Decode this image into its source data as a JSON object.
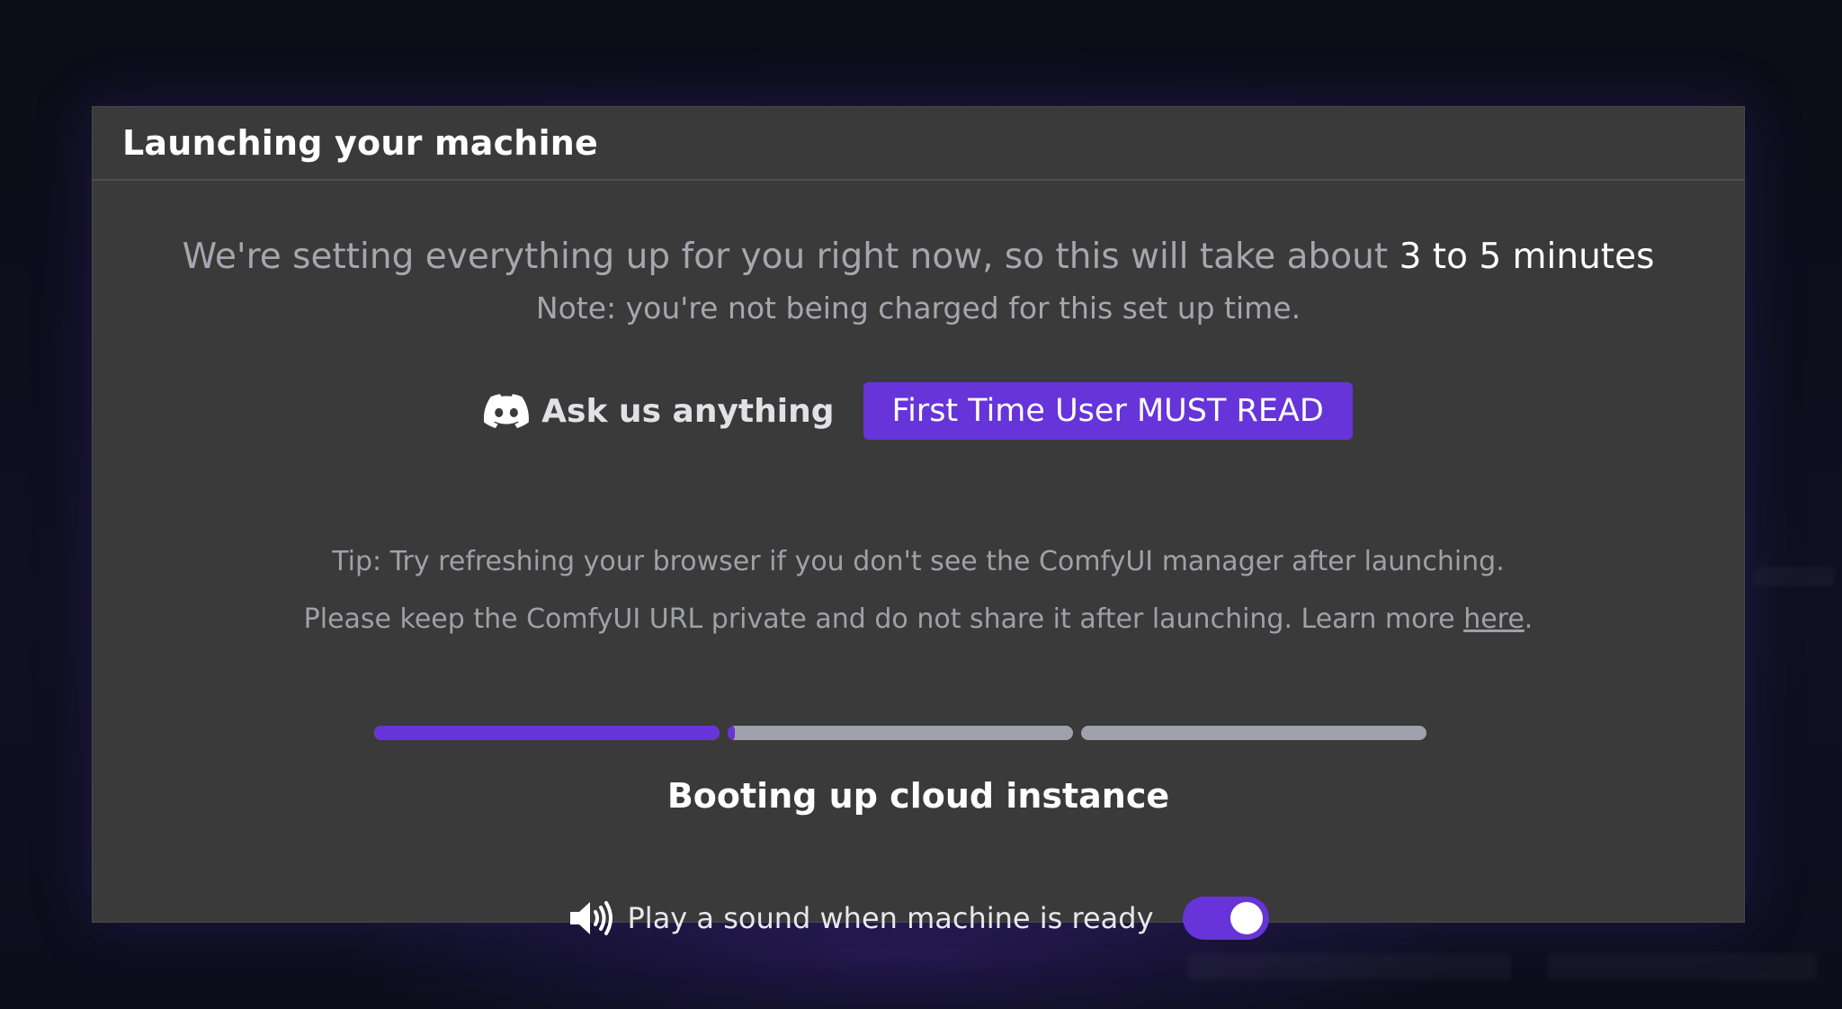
{
  "modal": {
    "title": "Launching your machine",
    "intro_text": "We're setting everything up for you right now, so this will take about",
    "intro_highlight": "3 to 5 minutes",
    "note": "Note: you're not being charged for this set up time.",
    "discord_label": "Ask us anything",
    "must_read_label": "First Time User MUST READ",
    "tip": "Tip: Try refreshing your browser if you don't see the ComfyUI manager after launching.",
    "privacy_text": "Please keep the ComfyUI URL private and do not share it after launching. Learn more",
    "privacy_link": "here",
    "privacy_end": ".",
    "progress": {
      "segments": [
        1.0,
        0.02,
        0.0
      ],
      "fill_color": "#6634d9",
      "track_color": "#9fa2ad"
    },
    "stage_label": "Booting up cloud instance",
    "sound_label": "Play a sound when machine is ready",
    "sound_enabled": true
  },
  "icons": {
    "discord": "discord-icon",
    "speaker": "speaker-icon"
  },
  "colors": {
    "accent": "#6634d9",
    "modal_bg": "#3a3a3a",
    "backdrop": "#0d0e1a"
  }
}
